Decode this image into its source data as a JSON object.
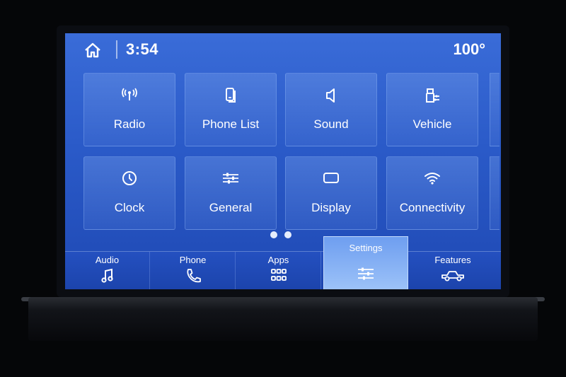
{
  "status_bar": {
    "home_icon": "home-icon",
    "time": "3:54",
    "temperature": "100°"
  },
  "tiles": [
    {
      "label": "Radio",
      "icon": "radio-antenna-icon"
    },
    {
      "label": "Phone List",
      "icon": "phone-list-icon"
    },
    {
      "label": "Sound",
      "icon": "speaker-icon"
    },
    {
      "label": "Vehicle",
      "icon": "vehicle-settings-icon"
    },
    {
      "label": "Clock",
      "icon": "clock-icon"
    },
    {
      "label": "General",
      "icon": "sliders-icon"
    },
    {
      "label": "Display",
      "icon": "display-icon"
    },
    {
      "label": "Connectivity",
      "icon": "wifi-icon"
    }
  ],
  "pager": {
    "pages": 2,
    "current": 1
  },
  "bottom_nav": [
    {
      "label": "Audio",
      "icon": "music-note-icon",
      "active": false
    },
    {
      "label": "Phone",
      "icon": "phone-icon",
      "active": false
    },
    {
      "label": "Apps",
      "icon": "apps-grid-icon",
      "active": false
    },
    {
      "label": "Settings",
      "icon": "settings-sliders-icon",
      "active": true
    },
    {
      "label": "Features",
      "icon": "truck-icon",
      "active": false
    }
  ],
  "colors": {
    "screen_top": "#3a6cd8",
    "screen_bottom": "#1f49b4",
    "active_tab": "#9cc2f8",
    "text": "#ffffff"
  }
}
